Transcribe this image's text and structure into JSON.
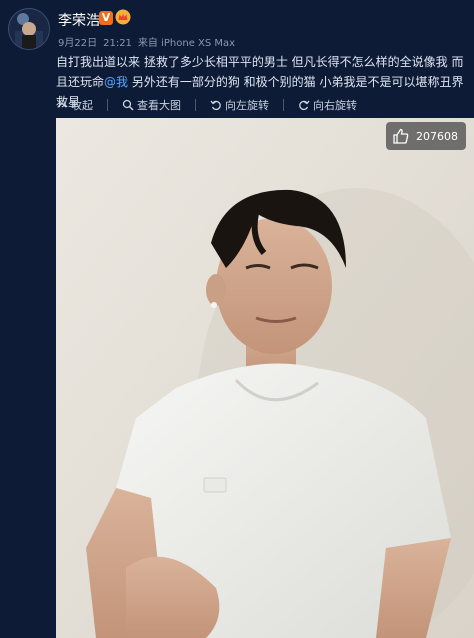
{
  "user": {
    "name": "李荣浩",
    "verified_badge": "V",
    "badges": [
      "verified-icon",
      "crown-icon"
    ]
  },
  "meta": {
    "date": "9月22日",
    "time": "21:21",
    "source": "来自 iPhone XS Max"
  },
  "post": {
    "text_before": "自打我出道以来 拯救了多少长相平平的男士 但凡长得不怎么样的全说像我 而且还玩命",
    "mention": "@我",
    "text_after": " 另外还有一部分的狗 和极个别的猫 小弟我是不是可以堪称丑界救星"
  },
  "toolbar": {
    "collapse": "收起",
    "view_large": "查看大图",
    "rotate_left": "向左旋转",
    "rotate_right": "向右旋转"
  },
  "image": {
    "like_count": "207608"
  },
  "colors": {
    "background": "#0d1b36",
    "mention": "#5aa9ff",
    "verified": "#f06d1a"
  }
}
